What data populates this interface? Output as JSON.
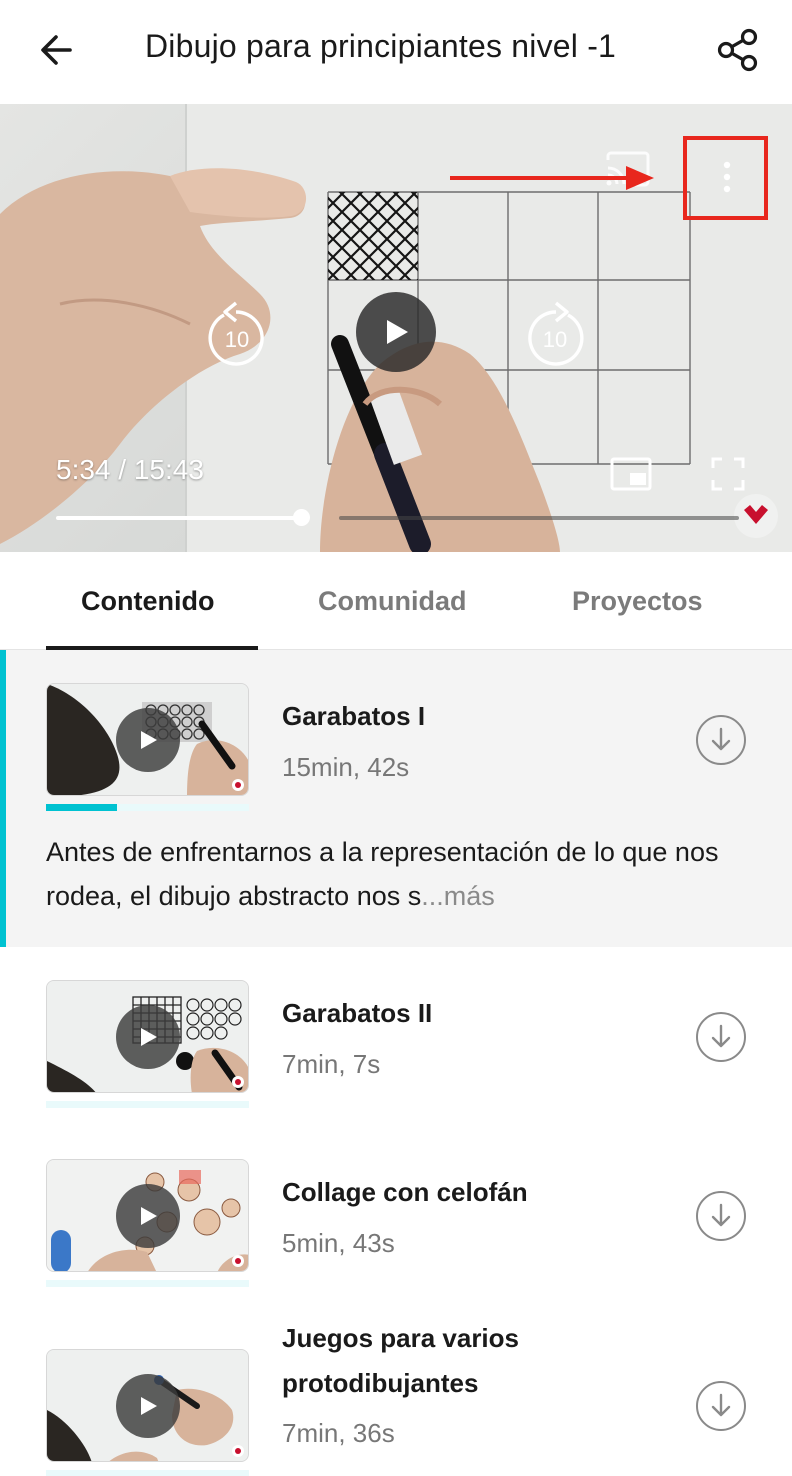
{
  "header": {
    "title": "Dibujo para principiantes nivel -1",
    "back_icon": "arrow-left-icon",
    "share_icon": "share-icon"
  },
  "player": {
    "time": "5:34 / 15:43",
    "progress_fraction": 0.354,
    "rewind_label": "10",
    "forward_label": "10",
    "cast_icon": "cast-icon",
    "menu_icon": "more-vertical-icon",
    "pip_icon": "picture-in-picture-icon",
    "fullscreen_icon": "fullscreen-icon",
    "highlight_color": "#e8271d"
  },
  "tabs": [
    {
      "label": "Contenido",
      "active": true
    },
    {
      "label": "Comunidad",
      "active": false
    },
    {
      "label": "Proyectos",
      "active": false
    }
  ],
  "lessons": [
    {
      "title": "Garabatos I",
      "duration": "15min, 42s",
      "progress": 0.35,
      "current": true,
      "description": "Antes de enfrentarnos a la representación de lo que nos rodea, el dibujo abstracto nos s",
      "more": "...más"
    },
    {
      "title": "Garabatos II",
      "duration": "7min, 7s",
      "progress": 0
    },
    {
      "title": "Collage con celofán",
      "duration": "5min, 43s",
      "progress": 0
    },
    {
      "title": "Juegos para varios protodibujantes",
      "duration": "7min, 36s",
      "progress": 0
    }
  ],
  "colors": {
    "accent": "#00c2d1",
    "brand": "#c8102e"
  }
}
